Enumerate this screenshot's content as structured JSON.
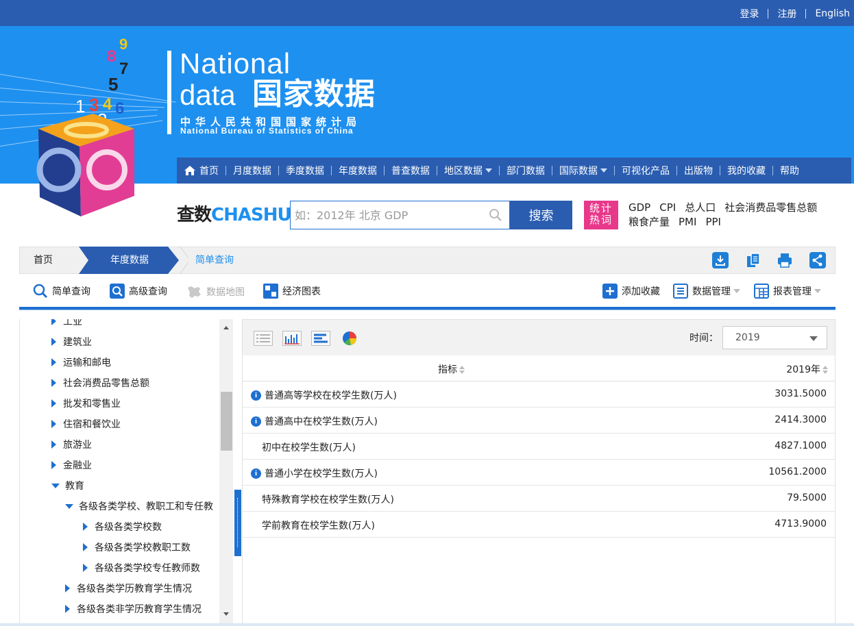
{
  "topbar": {
    "login": "登录",
    "register": "注册",
    "english": "English"
  },
  "logo": {
    "national": "National",
    "data": "data",
    "cn_name": "国家数据",
    "bureau_cn": "中华人民共和国国家统计局",
    "bureau_en": "National Bureau of Statistics of China",
    "cube_digits": "8 9 7 5 1 3 4 6 2"
  },
  "nav": {
    "items": [
      {
        "label": "首页",
        "icon": "home-icon"
      },
      {
        "label": "月度数据"
      },
      {
        "label": "季度数据"
      },
      {
        "label": "年度数据"
      },
      {
        "label": "普查数据"
      },
      {
        "label": "地区数据",
        "dropdown": true
      },
      {
        "label": "部门数据"
      },
      {
        "label": "国际数据",
        "dropdown": true
      },
      {
        "label": "可视化产品"
      },
      {
        "label": "出版物"
      },
      {
        "label": "我的收藏"
      },
      {
        "label": "帮助"
      }
    ]
  },
  "search": {
    "logo_a": "查数",
    "logo_b": "CHASHU",
    "placeholder": "如：2012年 北京 GDP",
    "button": "搜索",
    "hot_badge_1": "统计",
    "hot_badge_2": "热词",
    "hot_words_line1": [
      "GDP",
      "CPI",
      "总人口",
      "社会消费品零售总额"
    ],
    "hot_words_line2": [
      "粮食产量",
      "PMI",
      "PPI"
    ]
  },
  "breadcrumb": {
    "home": "首页",
    "section": "年度数据",
    "current": "简单查询"
  },
  "toolbar": {
    "simple_query": "简单查询",
    "advanced_query": "高级查询",
    "data_map": "数据地图",
    "econ_chart": "经济图表",
    "add_favorite": "添加收藏",
    "data_manage": "数据管理",
    "report_manage": "报表管理"
  },
  "tree": {
    "nodes": [
      {
        "label": "工业",
        "level": 0,
        "expanded": false
      },
      {
        "label": "建筑业",
        "level": 0,
        "expanded": false
      },
      {
        "label": "运输和邮电",
        "level": 0,
        "expanded": false
      },
      {
        "label": "社会消费品零售总额",
        "level": 0,
        "expanded": false
      },
      {
        "label": "批发和零售业",
        "level": 0,
        "expanded": false
      },
      {
        "label": "住宿和餐饮业",
        "level": 0,
        "expanded": false
      },
      {
        "label": "旅游业",
        "level": 0,
        "expanded": false
      },
      {
        "label": "金融业",
        "level": 0,
        "expanded": false
      },
      {
        "label": "教育",
        "level": 0,
        "expanded": true
      },
      {
        "label": "各级各类学校、教职工和专任教",
        "level": 1,
        "expanded": true
      },
      {
        "label": "各级各类学校数",
        "level": 2,
        "expanded": false
      },
      {
        "label": "各级各类学校教职工数",
        "level": 2,
        "expanded": false
      },
      {
        "label": "各级各类学校专任教师数",
        "level": 2,
        "expanded": false
      },
      {
        "label": "各级各类学历教育学生情况",
        "level": 1,
        "expanded": false
      },
      {
        "label": "各级各类非学历教育学生情况",
        "level": 1,
        "expanded": false
      }
    ]
  },
  "grid": {
    "time_label": "时间：",
    "time_value": "2019",
    "col_indicator": "指标",
    "col_year": "2019年",
    "rows": [
      {
        "name": "普通高等学校在校学生数(万人)",
        "value": "3031.5000",
        "info": true
      },
      {
        "name": "普通高中在校学生数(万人)",
        "value": "2414.3000",
        "info": true
      },
      {
        "name": "初中在校学生数(万人)",
        "value": "4827.1000",
        "info": false
      },
      {
        "name": "普通小学在校学生数(万人)",
        "value": "10561.2000",
        "info": true
      },
      {
        "name": "特殊教育学校在校学生数(万人)",
        "value": "79.5000",
        "info": false
      },
      {
        "name": "学前教育在校学生数(万人)",
        "value": "4713.9000",
        "info": false
      }
    ]
  },
  "colors": {
    "brand_blue": "#2a5db0",
    "banner_blue": "#1e90f0",
    "hot_pink": "#e8388a"
  }
}
